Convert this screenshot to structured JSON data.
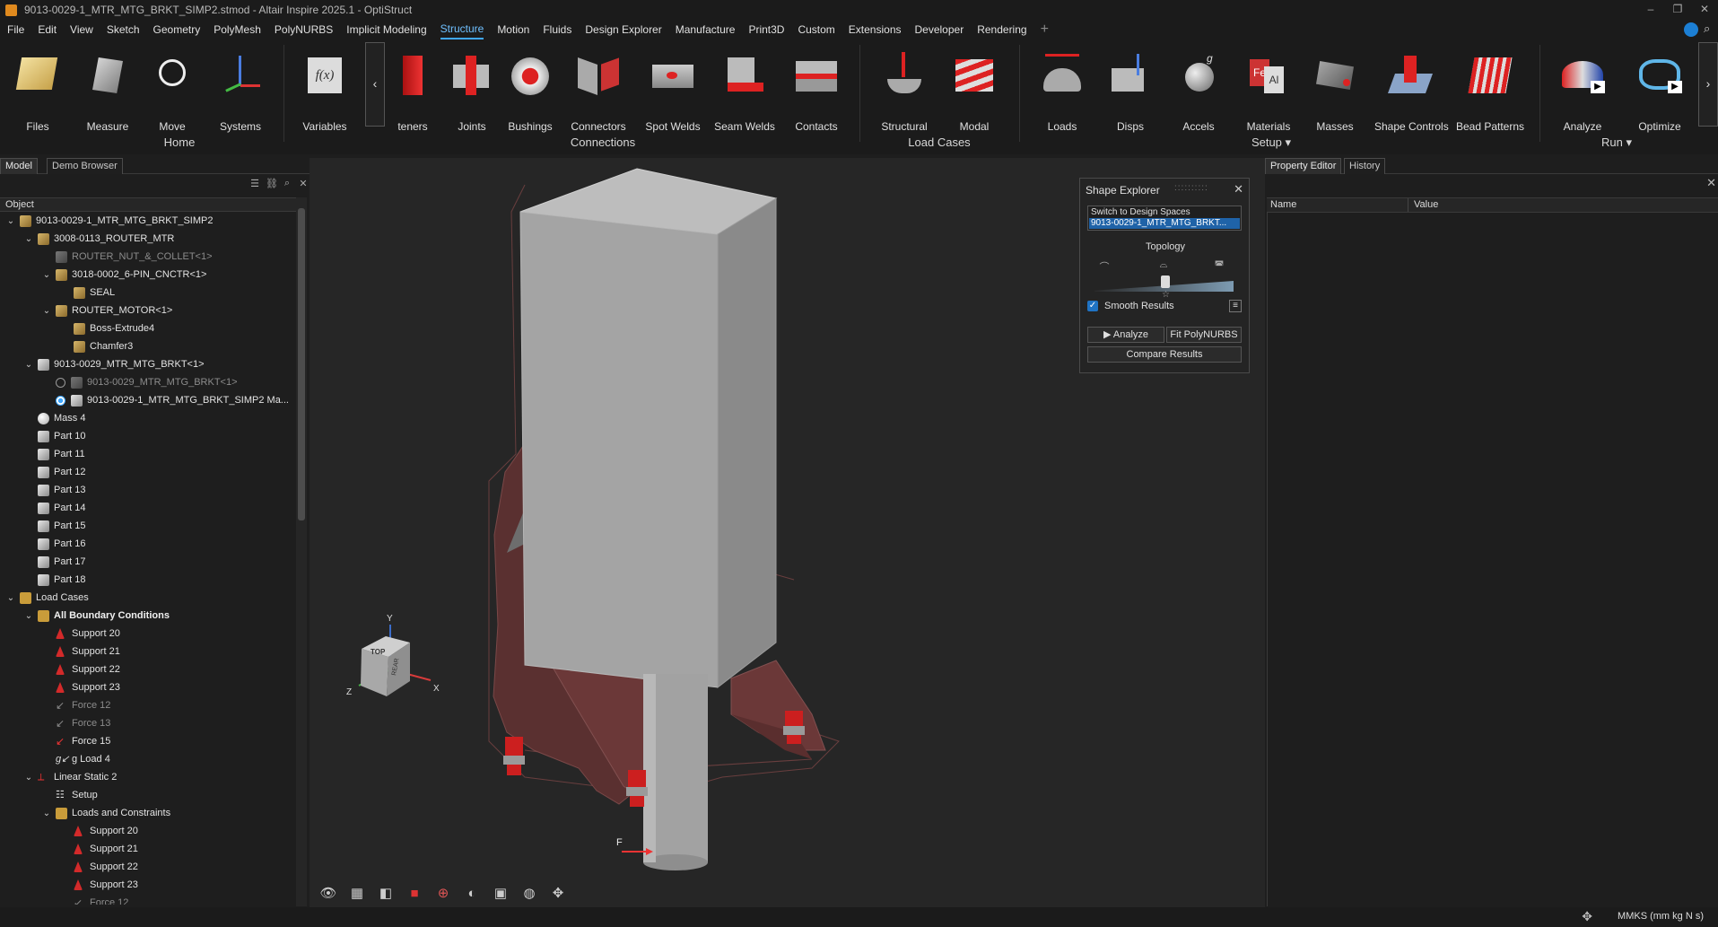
{
  "window": {
    "title": "9013-0029-1_MTR_MTG_BRKT_SIMP2.stmod - Altair Inspire 2025.1 - OptiStruct",
    "controls": [
      "–",
      "❐",
      "✕"
    ]
  },
  "menu": {
    "items": [
      "File",
      "Edit",
      "View",
      "Sketch",
      "Geometry",
      "PolyMesh",
      "PolyNURBS",
      "Implicit Modeling",
      "Structure",
      "Motion",
      "Fluids",
      "Design Explorer",
      "Manufacture",
      "Print3D",
      "Custom",
      "Extensions",
      "Developer",
      "Rendering"
    ],
    "active": "Structure",
    "plus": "+"
  },
  "ribbon": {
    "tools": [
      {
        "label": "Files",
        "icon": "files-icon"
      },
      {
        "label": "Measure",
        "icon": "measure-icon"
      },
      {
        "label": "Move",
        "icon": "move-icon"
      },
      {
        "label": "Systems",
        "icon": "systems-icon"
      },
      {
        "label": "Variables",
        "icon": "variables-icon",
        "glyph": "f(x)"
      },
      {
        "label": "teners",
        "icon": "fasteners-icon"
      },
      {
        "label": "Joints",
        "icon": "joints-icon"
      },
      {
        "label": "Bushings",
        "icon": "bushings-icon"
      },
      {
        "label": "Connectors",
        "icon": "connectors-icon"
      },
      {
        "label": "Spot Welds",
        "icon": "spot-welds-icon"
      },
      {
        "label": "Seam Welds",
        "icon": "seam-welds-icon"
      },
      {
        "label": "Contacts",
        "icon": "contacts-icon"
      },
      {
        "label": "Structural",
        "icon": "structural-icon"
      },
      {
        "label": "Modal",
        "icon": "modal-icon"
      },
      {
        "label": "Loads",
        "icon": "loads-icon"
      },
      {
        "label": "Disps",
        "icon": "disps-icon"
      },
      {
        "label": "Accels",
        "icon": "accels-icon"
      },
      {
        "label": "Materials",
        "icon": "materials-icon"
      },
      {
        "label": "Masses",
        "icon": "masses-icon"
      },
      {
        "label": "Shape Controls",
        "icon": "shape-controls-icon"
      },
      {
        "label": "Bead Patterns",
        "icon": "bead-patterns-icon"
      },
      {
        "label": "Analyze",
        "icon": "analyze-icon"
      },
      {
        "label": "Optimize",
        "icon": "optimize-icon"
      }
    ],
    "groups": [
      "Home",
      "Connections",
      "Load Cases",
      "Setup ▾",
      "Run ▾"
    ],
    "scroll_left": "‹",
    "scroll_right": "›"
  },
  "left_panel": {
    "tabs": [
      "Model",
      "Demo Browser"
    ],
    "tool_glyphs": [
      "☰",
      "⛓",
      "⌕",
      "✕"
    ],
    "column": "Object",
    "tree": [
      {
        "label": "9013-0029-1_MTR_MTG_BRKT_SIMP2",
        "indent": 0,
        "tw": "v",
        "icon": "asm"
      },
      {
        "label": "3008-0113_ROUTER_MTR",
        "indent": 1,
        "tw": "v",
        "icon": "asm"
      },
      {
        "label": "ROUTER_NUT_&_COLLET<1>",
        "indent": 2,
        "tw": "",
        "icon": "ghost",
        "style": "dim"
      },
      {
        "label": "3018-0002_6-PIN_CNCTR<1>",
        "indent": 2,
        "tw": "v",
        "icon": "asm"
      },
      {
        "label": "SEAL",
        "indent": 3,
        "tw": "",
        "icon": "asm"
      },
      {
        "label": "ROUTER_MOTOR<1>",
        "indent": 2,
        "tw": "v",
        "icon": "asm"
      },
      {
        "label": "Boss-Extrude4",
        "indent": 3,
        "tw": "",
        "icon": "asm"
      },
      {
        "label": "Chamfer3",
        "indent": 3,
        "tw": "",
        "icon": "asm"
      },
      {
        "label": "9013-0029_MTR_MTG_BRKT<1>",
        "indent": 1,
        "tw": "v",
        "icon": "part"
      },
      {
        "label": "9013-0029_MTR_MTG_BRKT<1>",
        "indent": 2,
        "tw": "",
        "icon": "ghost",
        "style": "dim",
        "radio": "off"
      },
      {
        "label": "9013-0029-1_MTR_MTG_BRKT_SIMP2 Ma...",
        "indent": 2,
        "tw": "",
        "icon": "part",
        "radio": "on"
      },
      {
        "label": "Mass 4",
        "indent": 1,
        "tw": "",
        "icon": "mass"
      },
      {
        "label": "Part 10",
        "indent": 1,
        "tw": "",
        "icon": "part"
      },
      {
        "label": "Part 11",
        "indent": 1,
        "tw": "",
        "icon": "part"
      },
      {
        "label": "Part 12",
        "indent": 1,
        "tw": "",
        "icon": "part"
      },
      {
        "label": "Part 13",
        "indent": 1,
        "tw": "",
        "icon": "part"
      },
      {
        "label": "Part 14",
        "indent": 1,
        "tw": "",
        "icon": "part"
      },
      {
        "label": "Part 15",
        "indent": 1,
        "tw": "",
        "icon": "part"
      },
      {
        "label": "Part 16",
        "indent": 1,
        "tw": "",
        "icon": "part"
      },
      {
        "label": "Part 17",
        "indent": 1,
        "tw": "",
        "icon": "part"
      },
      {
        "label": "Part 18",
        "indent": 1,
        "tw": "",
        "icon": "part"
      },
      {
        "label": "Load Cases",
        "indent": 0,
        "tw": "v",
        "icon": "folder"
      },
      {
        "label": "All Boundary Conditions",
        "indent": 1,
        "tw": "v",
        "icon": "folder",
        "style": "bold"
      },
      {
        "label": "Support 20",
        "indent": 2,
        "tw": "",
        "icon": "support"
      },
      {
        "label": "Support 21",
        "indent": 2,
        "tw": "",
        "icon": "support"
      },
      {
        "label": "Support 22",
        "indent": 2,
        "tw": "",
        "icon": "support"
      },
      {
        "label": "Support 23",
        "indent": 2,
        "tw": "",
        "icon": "support"
      },
      {
        "label": "Force 12",
        "indent": 2,
        "tw": "",
        "icon": "force-dim",
        "style": "dim"
      },
      {
        "label": "Force 13",
        "indent": 2,
        "tw": "",
        "icon": "force-dim",
        "style": "dim"
      },
      {
        "label": "Force 15",
        "indent": 2,
        "tw": "",
        "icon": "force"
      },
      {
        "label": "g Load 4",
        "indent": 2,
        "tw": "",
        "icon": "gload"
      },
      {
        "label": "Linear Static 2",
        "indent": 1,
        "tw": "v",
        "icon": "static"
      },
      {
        "label": "Setup",
        "indent": 2,
        "tw": "",
        "icon": "setup"
      },
      {
        "label": "Loads and Constraints",
        "indent": 2,
        "tw": "v",
        "icon": "folder"
      },
      {
        "label": "Support 20",
        "indent": 3,
        "tw": "",
        "icon": "support"
      },
      {
        "label": "Support 21",
        "indent": 3,
        "tw": "",
        "icon": "support"
      },
      {
        "label": "Support 22",
        "indent": 3,
        "tw": "",
        "icon": "support"
      },
      {
        "label": "Support 23",
        "indent": 3,
        "tw": "",
        "icon": "support"
      },
      {
        "label": "Force 12",
        "indent": 3,
        "tw": "",
        "icon": "force-dim",
        "style": "dim"
      }
    ]
  },
  "viewport": {
    "axes": {
      "x": "X",
      "y": "Y",
      "z": "Z"
    },
    "cube_faces": {
      "top": "TOP",
      "rear": "REAR"
    },
    "force_label": "F",
    "toolbar": [
      "view-icon",
      "snapshot-icon",
      "transparency-icon",
      "color-icon",
      "zoom-icon",
      "lighting-icon",
      "box-icon",
      "render-icon",
      "select-icon"
    ]
  },
  "shape_explorer": {
    "title": "Shape Explorer",
    "grip": "::::::::::",
    "switch_label": "Switch to Design Spaces",
    "switch_value": "9013-0029-1_MTR_MTG_BRKT...",
    "topology_label": "Topology",
    "topology_level": 0.5,
    "smooth_results_label": "Smooth Results",
    "smooth_results_checked": true,
    "analyze_label": "▶  Analyze",
    "fit_polynurbs_label": "Fit PolyNURBS",
    "compare_results_label": "Compare Results"
  },
  "right_panel": {
    "tabs": [
      "Property Editor",
      "History"
    ],
    "columns": [
      "Name",
      "Value"
    ]
  },
  "status": {
    "units": "MMKS (mm kg N s)"
  },
  "colors": {
    "accent": "#3fa7ff",
    "support_red": "#d32a2a",
    "bracket_maroon": "#6b3434",
    "motor_gray": "#9e9e9e"
  }
}
